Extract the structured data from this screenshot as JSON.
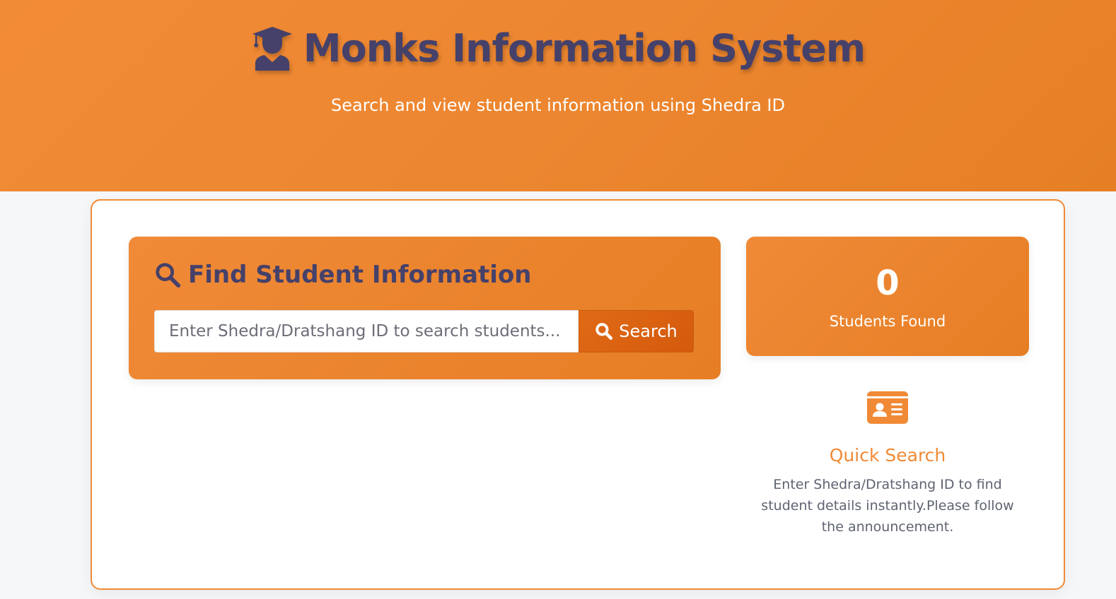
{
  "header": {
    "title": "Monks Information System",
    "subtitle": "Search and view student information using Shedra ID",
    "title_icon": "graduate-icon"
  },
  "search_panel": {
    "heading": "Find Student Information",
    "heading_icon": "search-icon",
    "input_placeholder": "Enter Shedra/Dratshang ID to search students...",
    "input_value": "",
    "button_label": "Search",
    "button_icon": "search-icon"
  },
  "stats": {
    "count": "0",
    "label": "Students Found"
  },
  "quick_search": {
    "icon": "id-card-icon",
    "title": "Quick Search",
    "description": "Enter Shedra/Dratshang ID to find student details instantly.Please follow the announcement."
  },
  "colors": {
    "brand_orange": "#f08a36",
    "brand_orange_dark": "#d45a0c",
    "heading_navy": "#45416a",
    "body_text": "#5e6370"
  }
}
